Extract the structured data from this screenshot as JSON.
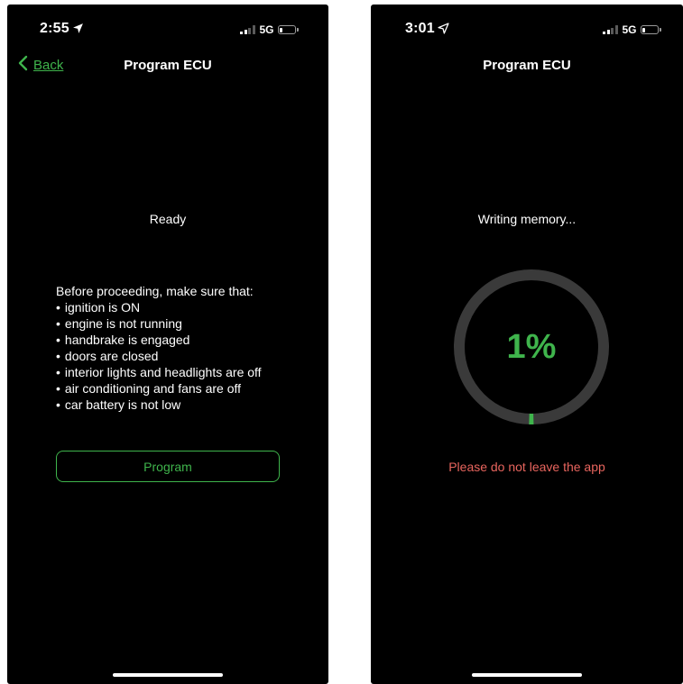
{
  "screens": [
    {
      "status": {
        "time": "2:55",
        "network": "5G"
      },
      "nav": {
        "back_label": "Back",
        "title": "Program ECU"
      },
      "state": "Ready",
      "checklist": {
        "heading": "Before proceeding, make sure that:",
        "items": [
          "ignition is ON",
          "engine is not running",
          "handbrake is engaged",
          "doors are closed",
          "interior lights and headlights are off",
          "air conditioning and fans are off",
          "car battery is not low"
        ]
      },
      "button_label": "Program"
    },
    {
      "status": {
        "time": "3:01",
        "network": "5G"
      },
      "nav": {
        "title": "Program ECU"
      },
      "state": "Writing memory...",
      "progress": {
        "label": "1%",
        "fraction": 0.01
      },
      "warning": "Please do not leave the app"
    }
  ],
  "colors": {
    "accent": "#3fb44c",
    "warning": "#e8655e",
    "background": "#000000",
    "ring_track": "#3a3a3a"
  },
  "icons": [
    "location-arrow-icon",
    "signal-icon",
    "battery-icon",
    "chevron-left-icon"
  ]
}
